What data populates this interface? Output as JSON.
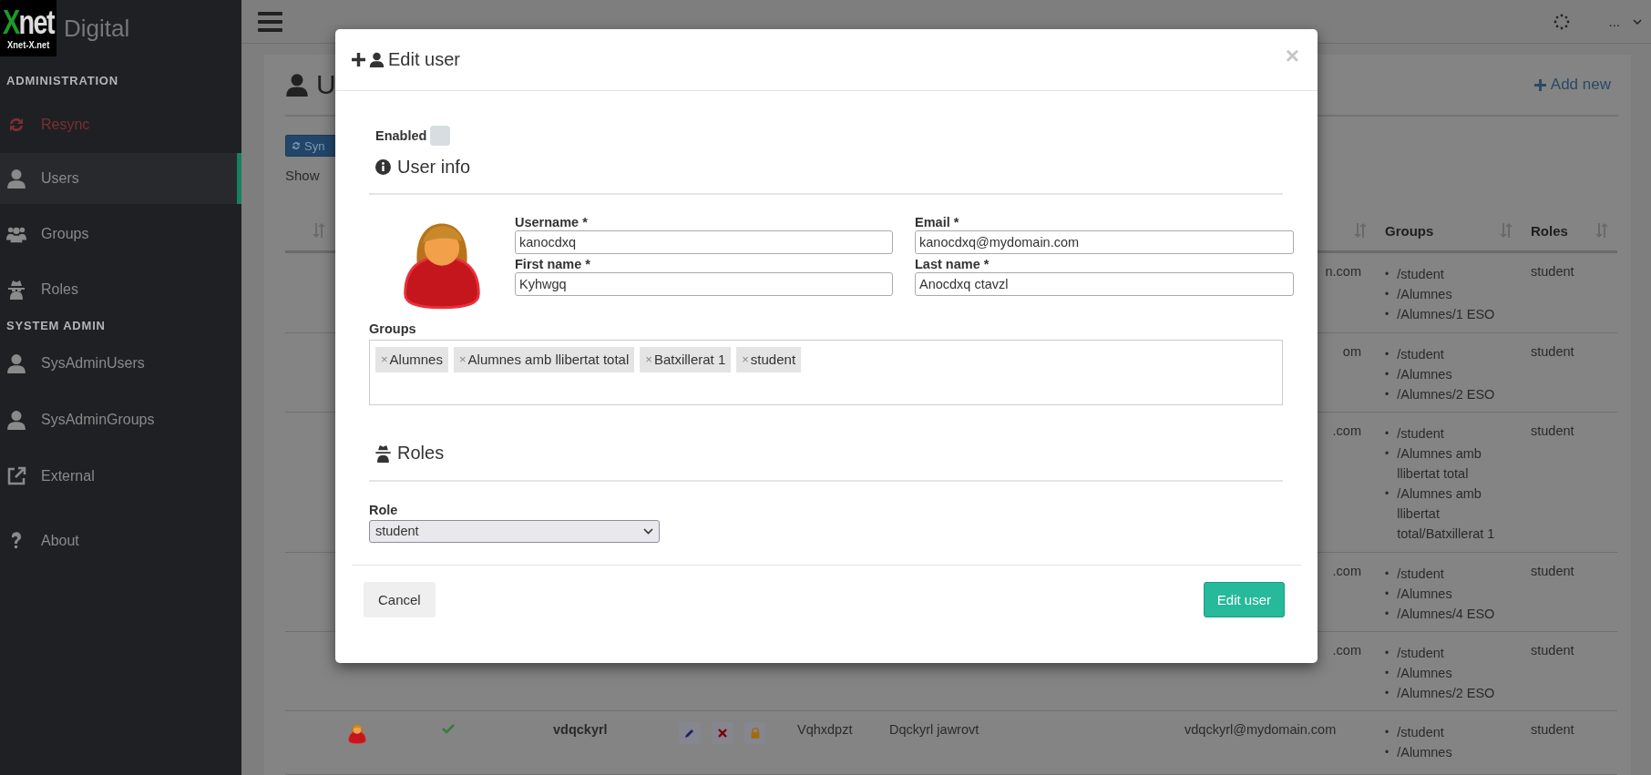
{
  "sidebar": {
    "logo": {
      "initial": "X",
      "rest": "net",
      "caption": "Xnet-X.net"
    },
    "brand": "Digital",
    "sections": [
      {
        "title": "ADMINISTRATION",
        "items": [
          {
            "label": "Resync",
            "kind": "danger",
            "selected": false
          },
          {
            "label": "Users",
            "kind": "normal",
            "selected": true
          },
          {
            "label": "Groups",
            "kind": "normal",
            "selected": false
          },
          {
            "label": "Roles",
            "kind": "normal",
            "selected": false
          }
        ]
      },
      {
        "title": "SYSTEM ADMIN",
        "items": [
          {
            "label": "SysAdminUsers",
            "kind": "normal",
            "selected": false
          },
          {
            "label": "SysAdminGroups",
            "kind": "normal",
            "selected": false
          },
          {
            "label": "External",
            "kind": "normal",
            "selected": false
          },
          {
            "label": "About",
            "kind": "normal",
            "selected": false
          }
        ]
      }
    ]
  },
  "topbar": {
    "user_menu": "..."
  },
  "page": {
    "title": "U",
    "sync_button": "Syn",
    "show_label": "Show",
    "add_new": "Add new"
  },
  "table": {
    "columns": [
      {
        "label": "Groups"
      },
      {
        "label": "Roles"
      }
    ],
    "rows": [
      {
        "email": "n.com",
        "groups": [
          {
            "bullet": "•",
            "label": "/student"
          },
          {
            "bullet": "•",
            "label": "/Alumnes"
          },
          {
            "bullet": "•",
            "label": "/Alumnes/1 ESO"
          }
        ],
        "roles": "student"
      },
      {
        "email": "om",
        "groups": [
          {
            "bullet": "•",
            "label": "/student"
          },
          {
            "bullet": "•",
            "label": "/Alumnes"
          },
          {
            "bullet": "•",
            "label": "/Alumnes/2 ESO"
          }
        ],
        "roles": "student"
      },
      {
        "email": ".com",
        "groups": [
          {
            "bullet": "•",
            "label": "/student"
          },
          {
            "bullet": "•",
            "label": "/Alumnes amb llibertat total"
          },
          {
            "bullet": "•",
            "label": "/Alumnes amb llibertat total/Batxillerat 1"
          }
        ],
        "roles": "student"
      },
      {
        "email": ".com",
        "groups": [
          {
            "bullet": "•",
            "label": "/student"
          },
          {
            "bullet": "•",
            "label": "/Alumnes"
          },
          {
            "bullet": "•",
            "label": "/Alumnes/4 ESO"
          }
        ],
        "roles": "student"
      },
      {
        "email": ".com",
        "groups": [
          {
            "bullet": "•",
            "label": "/student"
          },
          {
            "bullet": "•",
            "label": "/Alumnes"
          },
          {
            "bullet": "•",
            "label": "/Alumnes/2 ESO"
          }
        ],
        "roles": "student"
      },
      {
        "enabled": true,
        "username": "vdqckyrl",
        "first_name": "Vqhxdpzt",
        "last_name": "Dqckyrl jawrovt",
        "email": "vdqckyrl@mydomain.com",
        "groups": [
          {
            "bullet": "•",
            "label": "/student"
          },
          {
            "bullet": "•",
            "label": "/Alumnes"
          }
        ],
        "roles": "student"
      }
    ]
  },
  "modal": {
    "title": "Edit user",
    "close": "×",
    "enabled": {
      "label": "Enabled",
      "checked": false
    },
    "user_info": "User info",
    "fields": [
      {
        "label": "Username *",
        "value": "kanocdxq"
      },
      {
        "label": "Email *",
        "value": "kanocdxq@mydomain.com"
      },
      {
        "label": "First name *",
        "value": "Kyhwgq"
      },
      {
        "label": "Last name *",
        "value": "Anocdxq ctavzl"
      }
    ],
    "groups": {
      "label": "Groups",
      "tags": [
        {
          "remove": "×",
          "label": "Alumnes"
        },
        {
          "remove": "×",
          "label": "Alumnes amb llibertat total"
        },
        {
          "remove": "×",
          "label": "Batxillerat 1"
        },
        {
          "remove": "×",
          "label": "student"
        }
      ]
    },
    "roles": {
      "title": "Roles",
      "label": "Role",
      "value": "student"
    },
    "buttons": {
      "cancel": "Cancel",
      "submit": "Edit user"
    }
  }
}
